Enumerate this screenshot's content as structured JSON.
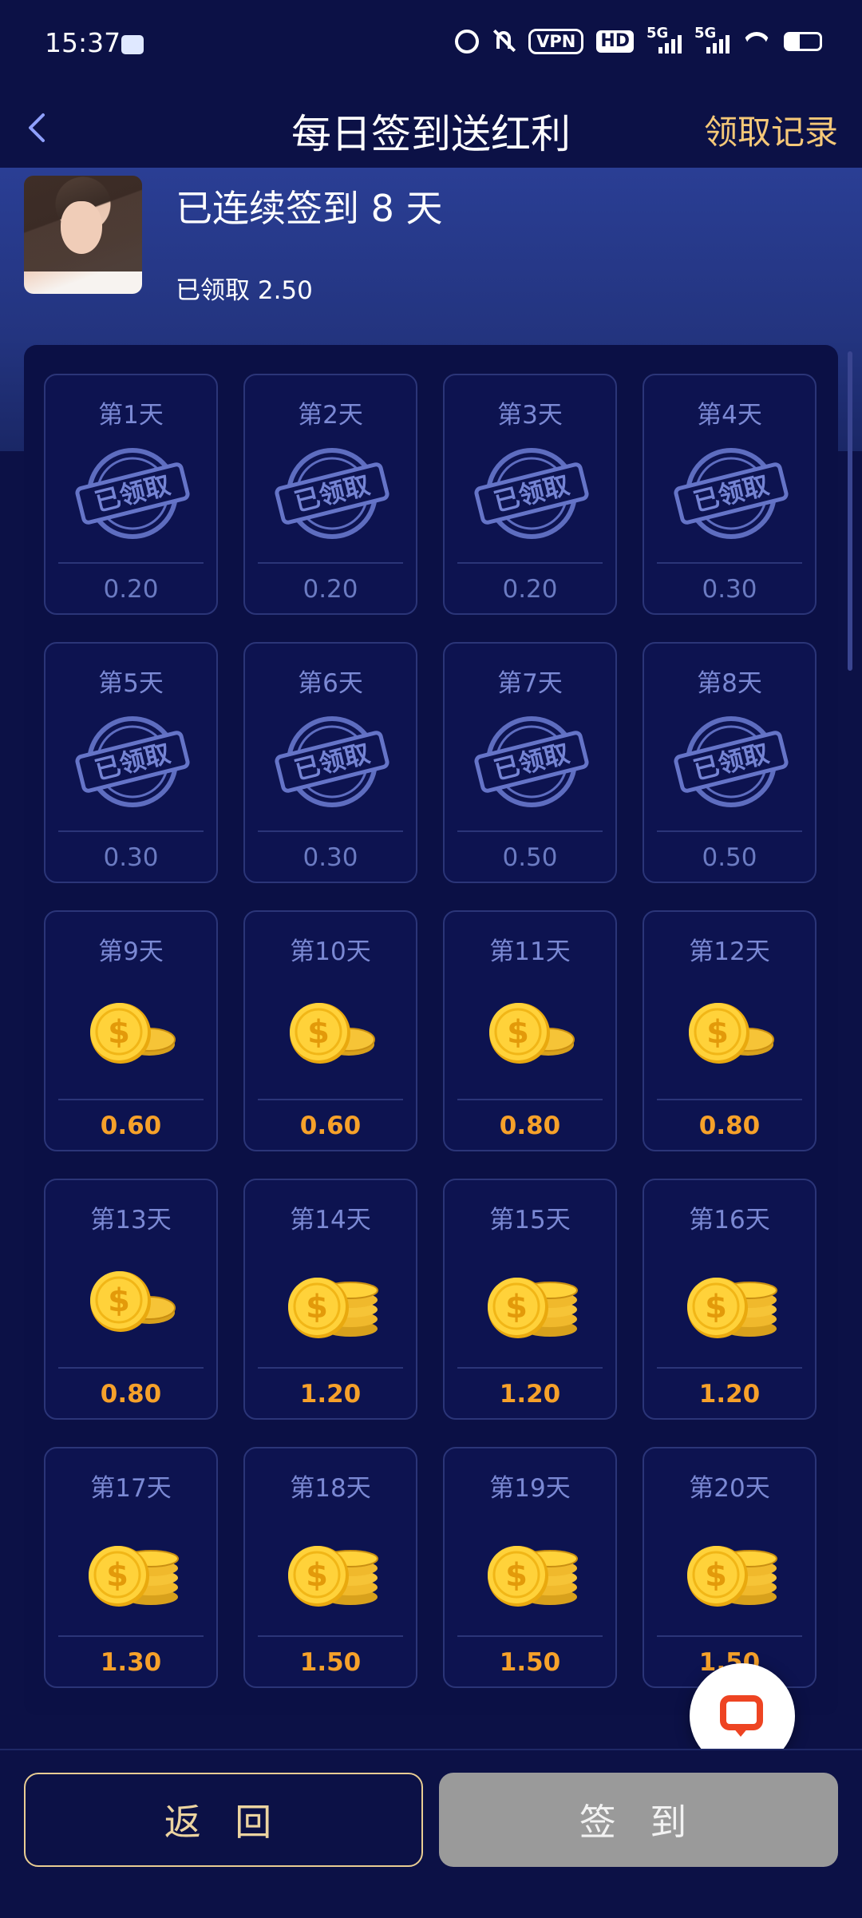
{
  "status_bar": {
    "time": "15:37",
    "vpn": "VPN",
    "hd": "HD",
    "sig1": "5G",
    "sig2": "5G",
    "battery_level": 0.4
  },
  "header": {
    "title": "每日签到送红利",
    "history_link": "领取记录"
  },
  "user": {
    "streak_text": "已连续签到 8 天",
    "received_text": "已领取 2.50"
  },
  "stamp_text": "已领取",
  "days": [
    {
      "label": "第1天",
      "amount": "0.20",
      "status": "claimed"
    },
    {
      "label": "第2天",
      "amount": "0.20",
      "status": "claimed"
    },
    {
      "label": "第3天",
      "amount": "0.20",
      "status": "claimed"
    },
    {
      "label": "第4天",
      "amount": "0.30",
      "status": "claimed"
    },
    {
      "label": "第5天",
      "amount": "0.30",
      "status": "claimed"
    },
    {
      "label": "第6天",
      "amount": "0.30",
      "status": "claimed"
    },
    {
      "label": "第7天",
      "amount": "0.50",
      "status": "claimed"
    },
    {
      "label": "第8天",
      "amount": "0.50",
      "status": "claimed"
    },
    {
      "label": "第9天",
      "amount": "0.60",
      "status": "pending",
      "coin": "small"
    },
    {
      "label": "第10天",
      "amount": "0.60",
      "status": "pending",
      "coin": "small"
    },
    {
      "label": "第11天",
      "amount": "0.80",
      "status": "pending",
      "coin": "small"
    },
    {
      "label": "第12天",
      "amount": "0.80",
      "status": "pending",
      "coin": "small"
    },
    {
      "label": "第13天",
      "amount": "0.80",
      "status": "pending",
      "coin": "small"
    },
    {
      "label": "第14天",
      "amount": "1.20",
      "status": "pending",
      "coin": "stack"
    },
    {
      "label": "第15天",
      "amount": "1.20",
      "status": "pending",
      "coin": "stack"
    },
    {
      "label": "第16天",
      "amount": "1.20",
      "status": "pending",
      "coin": "stack"
    },
    {
      "label": "第17天",
      "amount": "1.30",
      "status": "pending",
      "coin": "stack"
    },
    {
      "label": "第18天",
      "amount": "1.50",
      "status": "pending",
      "coin": "stack"
    },
    {
      "label": "第19天",
      "amount": "1.50",
      "status": "pending",
      "coin": "stack"
    },
    {
      "label": "第20天",
      "amount": "1.50",
      "status": "pending",
      "coin": "stack"
    }
  ],
  "buttons": {
    "return_label": "返 回",
    "sign_label": "签 到"
  },
  "colors": {
    "background": "#0c1146",
    "accent_gold": "#f5c878",
    "amount_orange": "#f6a12a",
    "claimed_blue": "#6b7bc2",
    "sign_disabled": "#9a9a9a"
  },
  "icons": {
    "back": "chevron-left-icon",
    "chat": "chat-bubble-icon",
    "stamp": "claimed-stamp-icon",
    "coin": "gold-coin-icon"
  }
}
